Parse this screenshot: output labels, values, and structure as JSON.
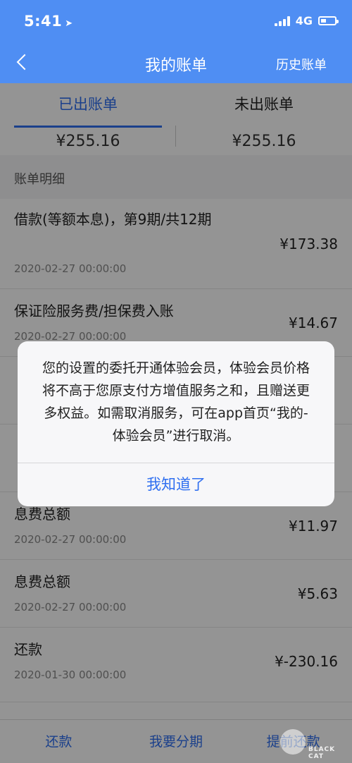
{
  "status_bar": {
    "time": "5:41",
    "network": "4G"
  },
  "nav": {
    "title": "我的账单",
    "right_label": "历史账单"
  },
  "tabs": [
    {
      "label": "已出账单",
      "amount": "¥255.16",
      "active": true
    },
    {
      "label": "未出账单",
      "amount": "¥255.16",
      "active": false
    }
  ],
  "section_title": "账单明细",
  "items": [
    {
      "title": "借款(等额本息)，第9期/共12期",
      "date": "2020-02-27 00:00:00",
      "amount": "¥173.38"
    },
    {
      "title": "保证险服务费/担保费入账",
      "date": "2020-02-27 00:00:00",
      "amount": "¥14.67"
    },
    {
      "title": "",
      "date": "",
      "amount": ""
    },
    {
      "title": "",
      "date": "",
      "amount": ""
    },
    {
      "title": "息费总额",
      "date": "2020-02-27 00:00:00",
      "amount": "¥11.97"
    },
    {
      "title": "息费总额",
      "date": "2020-02-27 00:00:00",
      "amount": "¥5.63"
    },
    {
      "title": "还款",
      "date": "2020-01-30 00:00:00",
      "amount": "¥-230.16"
    }
  ],
  "bottom_bar": {
    "repay": "还款",
    "installment": "我要分期",
    "early_repay": "提前还款"
  },
  "dialog": {
    "message": "您的设置的委托开通体验会员，体验会员价格将不高于您原支付方增值服务之和，且赠送更多权益。如需取消服务，可在app首页“我的-体验会员”进行取消。",
    "button": "我知道了"
  },
  "watermark": {
    "text": "BLACK CAT"
  },
  "colors": {
    "primary": "#4f8ef3",
    "accent": "#2f6ff0"
  }
}
